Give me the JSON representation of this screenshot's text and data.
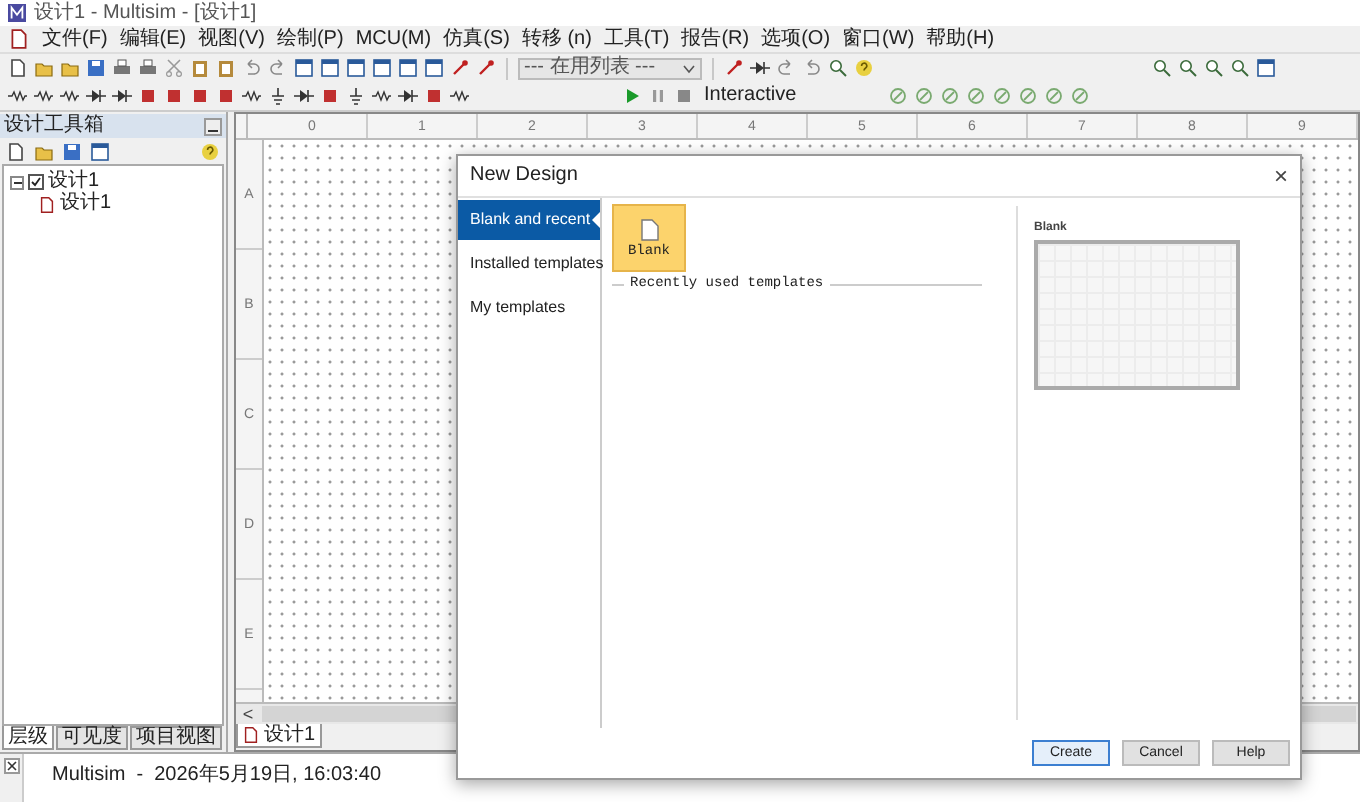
{
  "window": {
    "title": "设计1 - Multisim - [设计1]"
  },
  "menu": [
    "文件(F)",
    "编辑(E)",
    "视图(V)",
    "绘制(P)",
    "MCU(M)",
    "仿真(S)",
    "转移 (n)",
    "工具(T)",
    "报告(R)",
    "选项(O)",
    "窗口(W)",
    "帮助(H)"
  ],
  "toolbar": {
    "component_list": "--- 在用列表 ---",
    "mode": "Interactive"
  },
  "design_toolbox": {
    "title": "设计工具箱",
    "tree": [
      {
        "label": "设计1",
        "checked": true,
        "expanded": true,
        "children": [
          {
            "label": "设计1"
          }
        ]
      }
    ],
    "tabs": [
      {
        "label": "层级",
        "selected": true
      },
      {
        "label": "可见度",
        "selected": false
      },
      {
        "label": "项目视图",
        "selected": false
      }
    ]
  },
  "canvas": {
    "ruler_columns": [
      "0",
      "1",
      "2",
      "3",
      "4",
      "5",
      "6",
      "7",
      "8",
      "9"
    ],
    "ruler_rows": [
      "A",
      "B",
      "C",
      "D",
      "E"
    ],
    "scroll_left": "<",
    "tabs": [
      {
        "label": "设计1",
        "selected": true
      }
    ]
  },
  "status_bar": {
    "text": "Multisim  -  2026年5月19日, 16:03:40"
  },
  "dialog": {
    "title": "New Design",
    "close": "×",
    "nav": [
      {
        "label": "Blank and recent",
        "selected": true
      },
      {
        "label": "Installed templates",
        "selected": false
      },
      {
        "label": "My templates",
        "selected": false
      }
    ],
    "templates": [
      {
        "label": "Blank",
        "selected": true
      }
    ],
    "recent_heading": "Recently used templates",
    "preview_title": "Blank",
    "buttons": [
      {
        "label": "Create",
        "default": true
      },
      {
        "label": "Cancel",
        "default": false
      },
      {
        "label": "Help",
        "default": false
      }
    ]
  }
}
